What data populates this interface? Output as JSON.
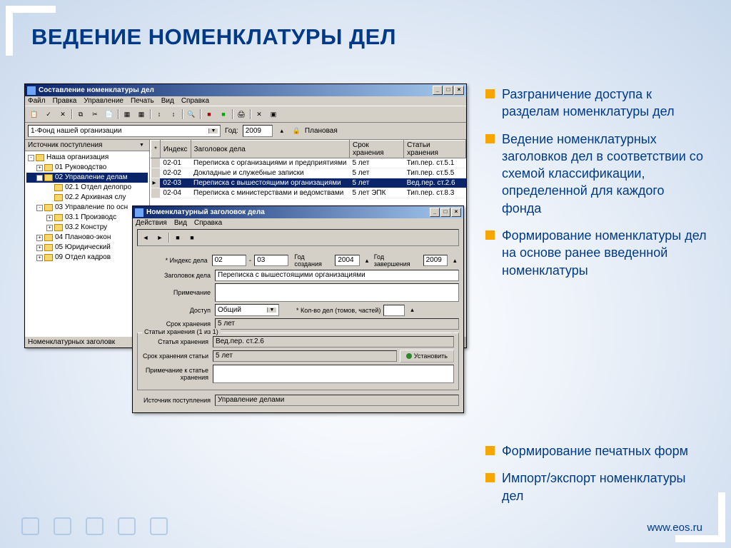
{
  "slide": {
    "title": "ВЕДЕНИЕ НОМЕНКЛАТУРЫ ДЕЛ",
    "bullets": [
      "Разграничение доступа к разделам номенклатуры дел",
      "Ведение номенклатурных заголовков дел в соответствии со схемой классификации, определенной для каждого фонда",
      "Формирование номенклатуры дел на основе ранее введенной номенклатуры"
    ],
    "bullets_wide": [
      "Формирование печатных форм",
      "Импорт/экспорт номенклатуры дел"
    ],
    "footer_url": "www.eos.ru"
  },
  "win1": {
    "title": "Составление номенклатуры дел",
    "menu": [
      "Файл",
      "Правка",
      "Управление",
      "Печать",
      "Вид",
      "Справка"
    ],
    "fond": "1-Фонд нашей организации",
    "year_label": "Год:",
    "year": "2009",
    "plan": "Плановая",
    "source_label": "Источник поступления",
    "tree": [
      {
        "indent": 0,
        "pm": "-",
        "label": "Наша организация",
        "sel": false
      },
      {
        "indent": 1,
        "pm": "+",
        "label": "01 Руководство",
        "sel": false
      },
      {
        "indent": 1,
        "pm": "-",
        "label": "02 Управление делам",
        "sel": true
      },
      {
        "indent": 2,
        "pm": "",
        "label": "02.1 Отдел делопро",
        "sel": false
      },
      {
        "indent": 2,
        "pm": "",
        "label": "02.2 Архивная слу",
        "sel": false
      },
      {
        "indent": 1,
        "pm": "-",
        "label": "03 Управление по осн",
        "sel": false
      },
      {
        "indent": 2,
        "pm": "+",
        "label": "03.1 Производс",
        "sel": false
      },
      {
        "indent": 2,
        "pm": "+",
        "label": "03.2 Констру",
        "sel": false
      },
      {
        "indent": 1,
        "pm": "+",
        "label": "04 Планово-экон",
        "sel": false
      },
      {
        "indent": 1,
        "pm": "+",
        "label": "05 Юридический",
        "sel": false
      },
      {
        "indent": 1,
        "pm": "+",
        "label": "09 Отдел кадров",
        "sel": false
      }
    ],
    "cols": [
      "*",
      "Индекс",
      "Заголовок дела",
      "Срок хранения",
      "Статьи хранения"
    ],
    "rows": [
      {
        "sel": false,
        "index": "02-01",
        "title": "Переписка с организациями и предприятиями",
        "term": "5 лет",
        "art": "Тип.пер. ст.5.1"
      },
      {
        "sel": false,
        "index": "02-02",
        "title": "Докладные и служебные записки",
        "term": "5 лет",
        "art": "Тип.пер. ст.5.5"
      },
      {
        "sel": true,
        "index": "02-03",
        "title": "Переписка с вышестоящими организациями",
        "term": "5 лет",
        "art": "Вед.пер. ст.2.6"
      },
      {
        "sel": false,
        "index": "02-04",
        "title": "Переписка с министерствами и ведомствами",
        "term": "5 лет ЭПК",
        "art": "Тип.пер. ст.8.3"
      }
    ],
    "status": "Номенклатурных заголовк"
  },
  "win2": {
    "title": "Номенклатурный заголовок дела",
    "menu": [
      "Действия",
      "Вид",
      "Справка"
    ],
    "labels": {
      "index": "* Индекс дела",
      "index_v1": "02",
      "index_sep": "-",
      "index_v2": "03",
      "year_create": "Год создания",
      "year_create_v": "2004",
      "year_end": "Год завершения",
      "year_end_v": "2009",
      "title": "Заголовок дела",
      "title_v": "Переписка с вышестоящими организациями",
      "note": "Примечание",
      "access": "Доступ",
      "access_v": "Общий",
      "vol": "* Кол-во дел (томов, частей)",
      "vol_v": "",
      "term": "Срок хранения",
      "term_v": "5 лет",
      "fieldset": "Статьи хранения (1 из 1)",
      "article": "Статья хранения",
      "article_v": "Вед.пер. ст.2.6",
      "article_term": "Срок хранения статьи",
      "article_term_v": "5 лет",
      "set_btn": "Установить",
      "note2": "Примечание к статье хранения",
      "source": "Источник поступления",
      "source_v": "Управление делами"
    }
  }
}
